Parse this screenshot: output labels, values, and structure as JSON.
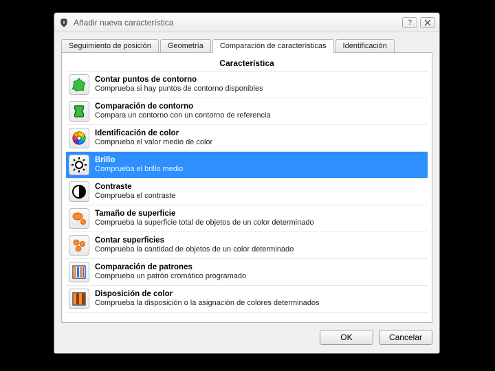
{
  "window": {
    "title": "Añadir nueva característica"
  },
  "tabs": {
    "t0": "Seguimiento de posición",
    "t1": "Geometría",
    "t2": "Comparación de características",
    "t3": "Identificación"
  },
  "header": "Característica",
  "items": [
    {
      "name": "Contar puntos de contorno",
      "desc": "Comprueba si hay puntos de contorno disponibles"
    },
    {
      "name": "Comparación de contorno",
      "desc": "Compara un contorno con un contorno de referencia"
    },
    {
      "name": "Identificación de color",
      "desc": "Comprueba el valor medio de color"
    },
    {
      "name": "Brillo",
      "desc": "Comprueba el brillo medio"
    },
    {
      "name": "Contraste",
      "desc": "Comprueba el contraste"
    },
    {
      "name": "Tamaño de superficie",
      "desc": "Comprueba la superficie total de objetos de un color determinado"
    },
    {
      "name": "Contar superficies",
      "desc": "Comprueba la cantidad de objetos de un color determinado"
    },
    {
      "name": "Comparación de patrones",
      "desc": "Comprueba un patrón cromático programado"
    },
    {
      "name": "Disposición de color",
      "desc": "Comprueba la disposición o la asignación de colores determinados"
    }
  ],
  "selected_index": 3,
  "buttons": {
    "ok": "OK",
    "cancel": "Cancelar"
  }
}
